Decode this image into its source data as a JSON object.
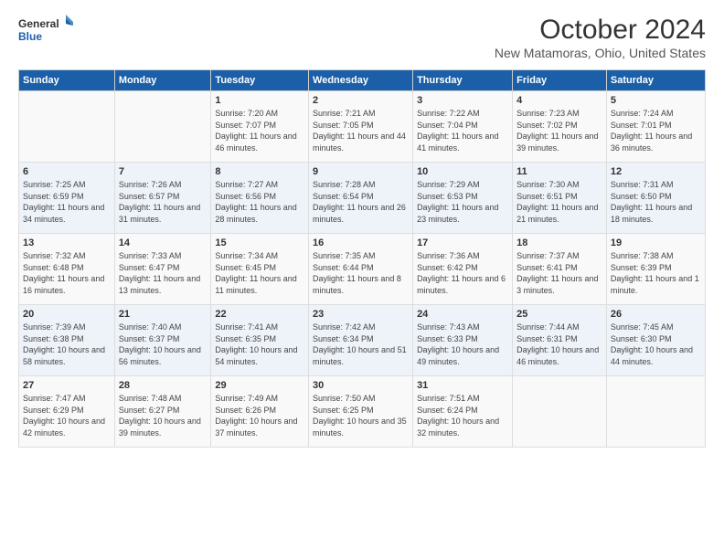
{
  "logo": {
    "line1": "General",
    "line2": "Blue"
  },
  "title": "October 2024",
  "subtitle": "New Matamoras, Ohio, United States",
  "headers": [
    "Sunday",
    "Monday",
    "Tuesday",
    "Wednesday",
    "Thursday",
    "Friday",
    "Saturday"
  ],
  "weeks": [
    [
      {
        "day": "",
        "details": ""
      },
      {
        "day": "",
        "details": ""
      },
      {
        "day": "1",
        "details": "Sunrise: 7:20 AM\nSunset: 7:07 PM\nDaylight: 11 hours and 46 minutes."
      },
      {
        "day": "2",
        "details": "Sunrise: 7:21 AM\nSunset: 7:05 PM\nDaylight: 11 hours and 44 minutes."
      },
      {
        "day": "3",
        "details": "Sunrise: 7:22 AM\nSunset: 7:04 PM\nDaylight: 11 hours and 41 minutes."
      },
      {
        "day": "4",
        "details": "Sunrise: 7:23 AM\nSunset: 7:02 PM\nDaylight: 11 hours and 39 minutes."
      },
      {
        "day": "5",
        "details": "Sunrise: 7:24 AM\nSunset: 7:01 PM\nDaylight: 11 hours and 36 minutes."
      }
    ],
    [
      {
        "day": "6",
        "details": "Sunrise: 7:25 AM\nSunset: 6:59 PM\nDaylight: 11 hours and 34 minutes."
      },
      {
        "day": "7",
        "details": "Sunrise: 7:26 AM\nSunset: 6:57 PM\nDaylight: 11 hours and 31 minutes."
      },
      {
        "day": "8",
        "details": "Sunrise: 7:27 AM\nSunset: 6:56 PM\nDaylight: 11 hours and 28 minutes."
      },
      {
        "day": "9",
        "details": "Sunrise: 7:28 AM\nSunset: 6:54 PM\nDaylight: 11 hours and 26 minutes."
      },
      {
        "day": "10",
        "details": "Sunrise: 7:29 AM\nSunset: 6:53 PM\nDaylight: 11 hours and 23 minutes."
      },
      {
        "day": "11",
        "details": "Sunrise: 7:30 AM\nSunset: 6:51 PM\nDaylight: 11 hours and 21 minutes."
      },
      {
        "day": "12",
        "details": "Sunrise: 7:31 AM\nSunset: 6:50 PM\nDaylight: 11 hours and 18 minutes."
      }
    ],
    [
      {
        "day": "13",
        "details": "Sunrise: 7:32 AM\nSunset: 6:48 PM\nDaylight: 11 hours and 16 minutes."
      },
      {
        "day": "14",
        "details": "Sunrise: 7:33 AM\nSunset: 6:47 PM\nDaylight: 11 hours and 13 minutes."
      },
      {
        "day": "15",
        "details": "Sunrise: 7:34 AM\nSunset: 6:45 PM\nDaylight: 11 hours and 11 minutes."
      },
      {
        "day": "16",
        "details": "Sunrise: 7:35 AM\nSunset: 6:44 PM\nDaylight: 11 hours and 8 minutes."
      },
      {
        "day": "17",
        "details": "Sunrise: 7:36 AM\nSunset: 6:42 PM\nDaylight: 11 hours and 6 minutes."
      },
      {
        "day": "18",
        "details": "Sunrise: 7:37 AM\nSunset: 6:41 PM\nDaylight: 11 hours and 3 minutes."
      },
      {
        "day": "19",
        "details": "Sunrise: 7:38 AM\nSunset: 6:39 PM\nDaylight: 11 hours and 1 minute."
      }
    ],
    [
      {
        "day": "20",
        "details": "Sunrise: 7:39 AM\nSunset: 6:38 PM\nDaylight: 10 hours and 58 minutes."
      },
      {
        "day": "21",
        "details": "Sunrise: 7:40 AM\nSunset: 6:37 PM\nDaylight: 10 hours and 56 minutes."
      },
      {
        "day": "22",
        "details": "Sunrise: 7:41 AM\nSunset: 6:35 PM\nDaylight: 10 hours and 54 minutes."
      },
      {
        "day": "23",
        "details": "Sunrise: 7:42 AM\nSunset: 6:34 PM\nDaylight: 10 hours and 51 minutes."
      },
      {
        "day": "24",
        "details": "Sunrise: 7:43 AM\nSunset: 6:33 PM\nDaylight: 10 hours and 49 minutes."
      },
      {
        "day": "25",
        "details": "Sunrise: 7:44 AM\nSunset: 6:31 PM\nDaylight: 10 hours and 46 minutes."
      },
      {
        "day": "26",
        "details": "Sunrise: 7:45 AM\nSunset: 6:30 PM\nDaylight: 10 hours and 44 minutes."
      }
    ],
    [
      {
        "day": "27",
        "details": "Sunrise: 7:47 AM\nSunset: 6:29 PM\nDaylight: 10 hours and 42 minutes."
      },
      {
        "day": "28",
        "details": "Sunrise: 7:48 AM\nSunset: 6:27 PM\nDaylight: 10 hours and 39 minutes."
      },
      {
        "day": "29",
        "details": "Sunrise: 7:49 AM\nSunset: 6:26 PM\nDaylight: 10 hours and 37 minutes."
      },
      {
        "day": "30",
        "details": "Sunrise: 7:50 AM\nSunset: 6:25 PM\nDaylight: 10 hours and 35 minutes."
      },
      {
        "day": "31",
        "details": "Sunrise: 7:51 AM\nSunset: 6:24 PM\nDaylight: 10 hours and 32 minutes."
      },
      {
        "day": "",
        "details": ""
      },
      {
        "day": "",
        "details": ""
      }
    ]
  ]
}
